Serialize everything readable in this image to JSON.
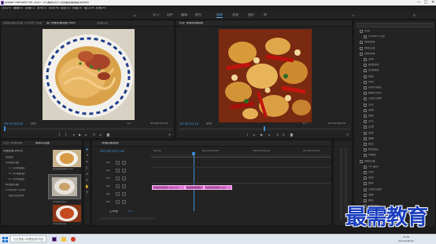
{
  "window": {
    "title": "Adobe Premiere Pro 2020 - D:\\案例\\5\\5.3\\快速剪辑视频.prproj",
    "minimize": "—",
    "maximize": "□",
    "close": "✕"
  },
  "menu": [
    "文件(F)",
    "编辑(E)",
    "剪辑(C)",
    "序列(S)",
    "标记(M)",
    "图形(G)",
    "视图(V)",
    "窗口(W)",
    "帮助(H)"
  ],
  "workspaces": [
    "学习",
    "组件",
    "编辑",
    "颜色",
    "效果",
    "音频",
    "图形",
    "库"
  ],
  "workspace_active": "效果",
  "source_monitor": {
    "tabs": [
      "音频剪辑混合器",
      "Lumetri 范围",
      "源: 快速剪辑视频.mp4",
      "效果控件"
    ],
    "timecode_left": "00:00:00:00",
    "fit_label": "适合",
    "scale": "1/2",
    "timecode_right": "00:00:05:00"
  },
  "program_monitor": {
    "tab": "节目: 快速剪辑视频",
    "timecode_left": "00:00:03:19",
    "fit_label": "适合",
    "scale": "1/2",
    "timecode_right": "00:00:05:00"
  },
  "project_panel": {
    "tabs": [
      "项目: 快速剪辑",
      "媒体浏览器"
    ],
    "path": "快速剪辑.prproj",
    "tree": [
      "收藏夹",
      "本地驱动器",
      "C: (本地磁盘)",
      "D: (本地磁盘)",
      "E: (本地磁盘)",
      "网络驱动器",
      "Creative Cloud",
      "团队项目版本"
    ],
    "thumb_captions": [
      "快速剪辑视频.mp4",
      "image2.jpg",
      "image3.jpg"
    ]
  },
  "timeline": {
    "tab": "快速剪辑视频",
    "timecode": "00:00:03:19",
    "ruler": [
      "00:00",
      "00:00:05:00",
      "00:00:10:00",
      "00:00:15:00"
    ],
    "tracks": [
      "V3",
      "V2",
      "V1",
      "A1",
      "A2",
      "A3"
    ],
    "master_label": "主声道",
    "master_value": "0.0",
    "clips": [
      {
        "name": "快速剪辑视频.mp4 [V]"
      },
      {
        "name": "快速剪辑视频.mp4"
      },
      {
        "name": "快速剪辑视频.mp4"
      }
    ]
  },
  "effects_panel": {
    "tree": [
      "预设",
      "Lumetri 预设",
      "音频效果",
      "音频过渡",
      "视频效果",
      "变换",
      "图像控制",
      "实用程序",
      "扭曲",
      "时间",
      "杂色与颗粒",
      "模糊与锐化",
      "沉浸式视频",
      "生成",
      "视频",
      "调整",
      "过时",
      "过渡",
      "透视",
      "通道",
      "键控",
      "颜色校正",
      "风格化",
      "视频过渡",
      "3D 运动",
      "内滑",
      "划像",
      "擦除",
      "沉浸式视频",
      "溶解",
      "缩放",
      "页面剥落"
    ]
  },
  "taskbar": {
    "search_placeholder": "在这里输入你要搜索的内容",
    "time": "9:16",
    "date": "2021/10/15"
  },
  "watermark": "最需教育",
  "colors": {
    "accent": "#3d8fd6",
    "clip": "#e078d6",
    "playhead": "#3d7fd8",
    "watermark": "#1b3fbf"
  }
}
